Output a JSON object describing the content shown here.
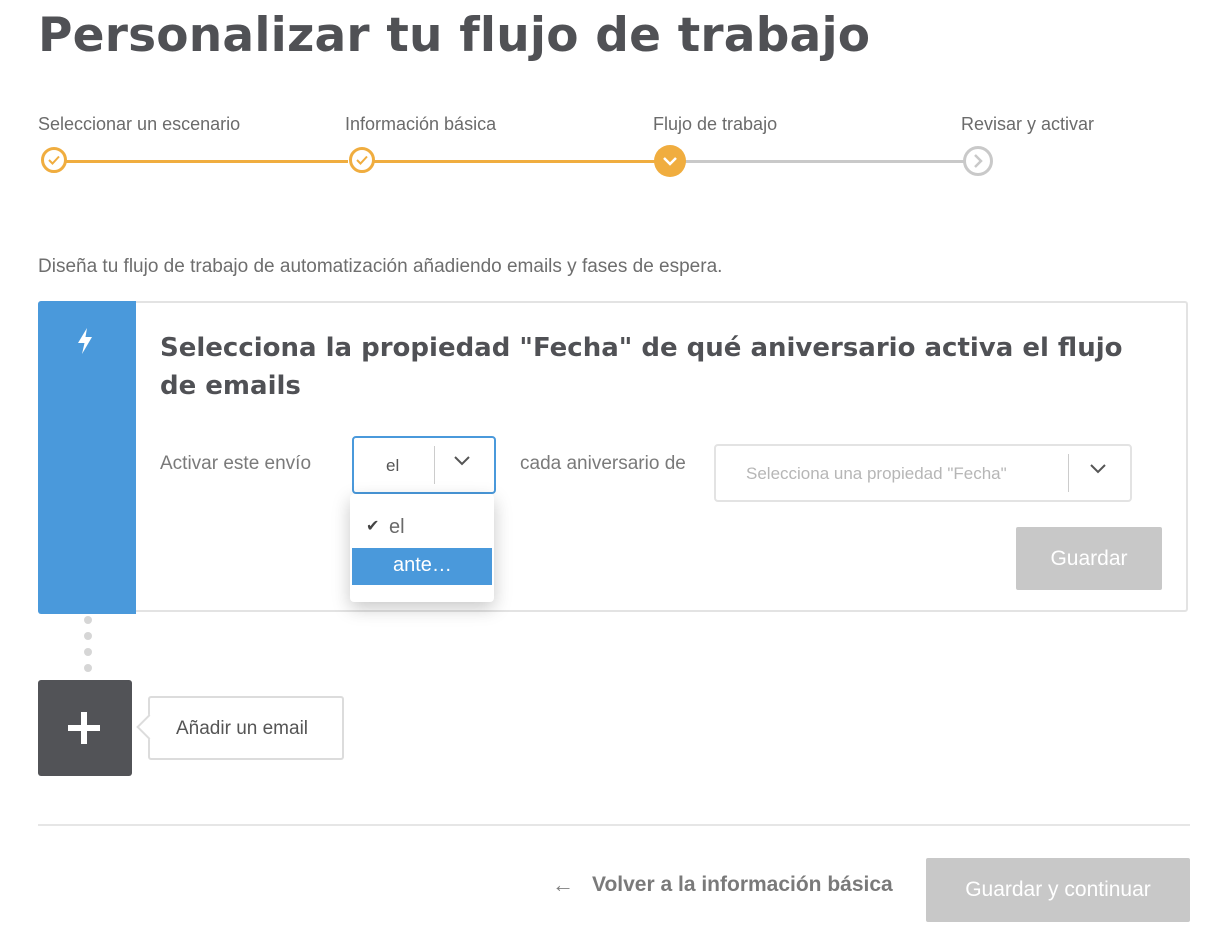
{
  "page": {
    "title": "Personalizar tu flujo de trabajo",
    "intro": "Diseña tu flujo de trabajo de automatización añadiendo emails y fases de espera."
  },
  "stepper": {
    "steps": [
      {
        "label": "Seleccionar un escenario",
        "state": "completed"
      },
      {
        "label": "Información básica",
        "state": "completed"
      },
      {
        "label": "Flujo de trabajo",
        "state": "current"
      },
      {
        "label": "Revisar y activar",
        "state": "pending"
      }
    ],
    "colors": {
      "active": "#f0ad3f",
      "inactive": "#c9c9c9"
    }
  },
  "trigger": {
    "icon": "lightning-bolt-icon",
    "accent": "#4a99db",
    "title": "Selecciona la propiedad \"Fecha\" de qué aniversario activa el flujo de emails",
    "activate_label": "Activar este envío",
    "timing_value": "el",
    "every_label": "cada aniversario de",
    "property_placeholder": "Selecciona una propiedad \"Fecha\"",
    "save_label": "Guardar",
    "dropdown_options": [
      {
        "label": "el",
        "checked": true,
        "highlighted": false
      },
      {
        "label": "ante…",
        "checked": false,
        "highlighted": true
      }
    ]
  },
  "workflow": {
    "add_email_tooltip": "Añadir un email"
  },
  "footer": {
    "back_label": "Volver a la información básica",
    "continue_label": "Guardar y continuar"
  }
}
